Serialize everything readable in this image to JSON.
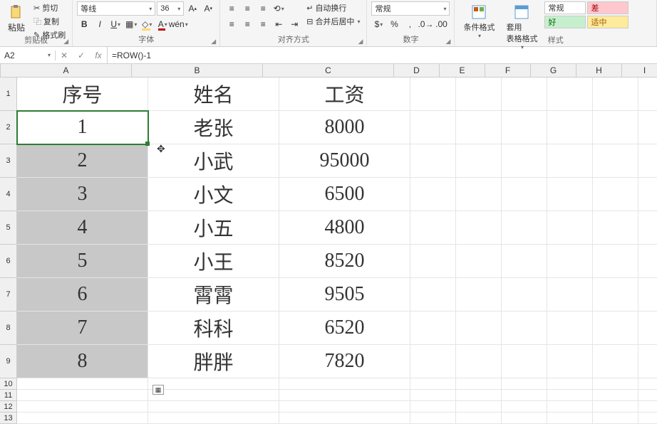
{
  "ribbon": {
    "clipboard": {
      "label": "剪贴板",
      "cut": "剪切",
      "copy": "复制",
      "format_painter": "格式刷",
      "paste": "粘贴"
    },
    "font": {
      "label": "字体",
      "name": "等线",
      "size": "36"
    },
    "alignment": {
      "label": "对齐方式",
      "wrap": "自动换行",
      "merge": "合并后居中"
    },
    "number": {
      "label": "数字",
      "format": "常规"
    },
    "styles": {
      "label": "样式",
      "cond_format": "条件格式",
      "table_format": "套用\n表格格式",
      "normal": "常规",
      "bad": "差",
      "good": "好",
      "neutral": "适中"
    }
  },
  "formula_bar": {
    "cell_ref": "A2",
    "formula": "=ROW()-1"
  },
  "columns": [
    "A",
    "B",
    "C",
    "D",
    "E",
    "F",
    "G",
    "H",
    "I"
  ],
  "rows": [
    "1",
    "2",
    "3",
    "4",
    "5",
    "6",
    "7",
    "8",
    "9",
    "10",
    "11",
    "12",
    "13"
  ],
  "chart_data": {
    "type": "table",
    "headers": [
      "序号",
      "姓名",
      "工资"
    ],
    "records": [
      {
        "no": "1",
        "name": "老张",
        "salary": "8000"
      },
      {
        "no": "2",
        "name": "小武",
        "salary": "95000"
      },
      {
        "no": "3",
        "name": "小文",
        "salary": "6500"
      },
      {
        "no": "4",
        "name": "小五",
        "salary": "4800"
      },
      {
        "no": "5",
        "name": "小王",
        "salary": "8520"
      },
      {
        "no": "6",
        "name": "霄霄",
        "salary": "9505"
      },
      {
        "no": "7",
        "name": "科科",
        "salary": "6520"
      },
      {
        "no": "8",
        "name": "胖胖",
        "salary": "7820"
      }
    ]
  }
}
